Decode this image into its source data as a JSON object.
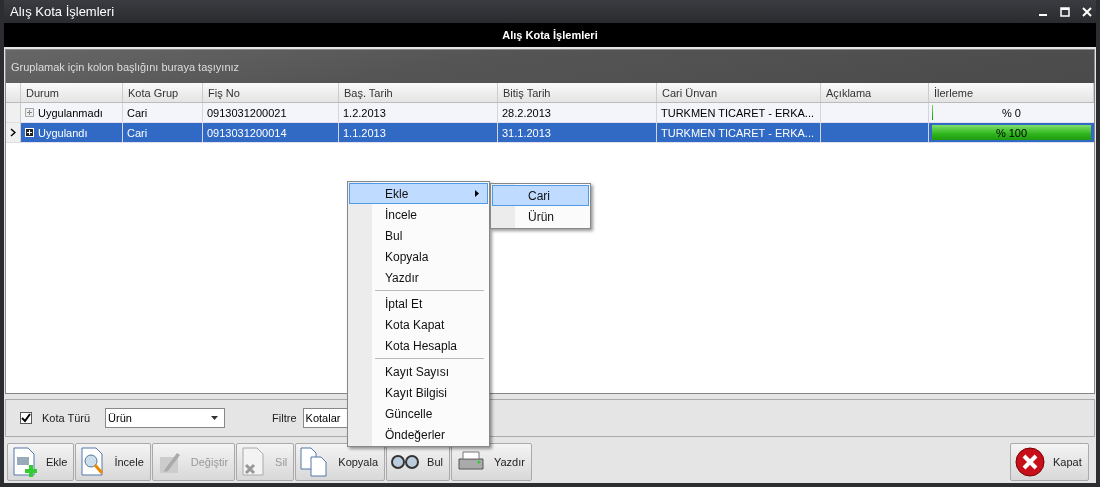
{
  "window": {
    "title": "Alış Kota İşlemleri"
  },
  "header": "Alış Kota İşlemleri",
  "group_panel": {
    "hint": "Gruplamak için kolon başlığını buraya taşıyınız"
  },
  "table": {
    "columns": [
      "Durum",
      "Kota Grup",
      "Fiş No",
      "Baş. Tarih",
      "Bitiş Tarih",
      "Cari Ünvan",
      "Açıklama",
      "İlerleme"
    ],
    "rows": [
      {
        "selected": false,
        "expanded": false,
        "cells": [
          "Uygulanmadı",
          "Cari",
          "0913031200021",
          "1.2.2013",
          "28.2.2013",
          "TURKMEN TICARET - ERKA...",
          ""
        ],
        "progress": {
          "level": 0,
          "reading": "% 0"
        }
      },
      {
        "selected": true,
        "expanded": false,
        "cells": [
          "Uygulandı",
          "Cari",
          "0913031200014",
          "1.1.2013",
          "31.1.2013",
          "TURKMEN TICARET - ERKA...",
          ""
        ],
        "progress": {
          "level": 1,
          "reading": "% 100"
        }
      }
    ]
  },
  "filter_bar": {
    "kota_turu": {
      "label": "Kota Türü",
      "checked": true
    },
    "kota_turu_value": "Ürün",
    "filtre": {
      "label": "Filtre",
      "value": "Kotalar"
    }
  },
  "toolbar": [
    {
      "kind": "add",
      "label": "Ekle",
      "disabled": false
    },
    {
      "kind": "inspect",
      "label": "İncele",
      "disabled": false
    },
    {
      "kind": "edit",
      "label": "Değiştir",
      "disabled": true
    },
    {
      "kind": "delete",
      "label": "Sil",
      "disabled": true
    },
    {
      "kind": "copy",
      "label": "Kopyala",
      "disabled": false
    },
    {
      "kind": "find",
      "label": "Bul",
      "disabled": false
    },
    {
      "kind": "print",
      "label": "Yazdır",
      "disabled": false
    }
  ],
  "close_button": "Kapat",
  "context_menu": {
    "groups": [
      [
        {
          "label": "Ekle",
          "selected": true,
          "submenu": true
        },
        {
          "label": "İncele",
          "selected": false,
          "submenu": false
        },
        {
          "label": "Bul",
          "selected": false,
          "submenu": false
        },
        {
          "label": "Kopyala",
          "selected": false,
          "submenu": false
        },
        {
          "label": "Yazdır",
          "selected": false,
          "submenu": false
        }
      ],
      [
        {
          "label": "İptal Et",
          "selected": false,
          "submenu": false
        },
        {
          "label": "Kota Kapat",
          "selected": false,
          "submenu": false
        },
        {
          "label": "Kota Hesapla",
          "selected": false,
          "submenu": false
        }
      ],
      [
        {
          "label": "Kayıt Sayısı",
          "selected": false,
          "submenu": false
        },
        {
          "label": "Kayıt Bilgisi",
          "selected": false,
          "submenu": false
        },
        {
          "label": "Güncelle",
          "selected": false,
          "submenu": false
        },
        {
          "label": "Öndeğerler",
          "selected": false,
          "submenu": false
        }
      ]
    ],
    "submenu": [
      {
        "label": "Cari",
        "selected": true
      },
      {
        "label": "Ürün",
        "selected": false
      }
    ]
  }
}
